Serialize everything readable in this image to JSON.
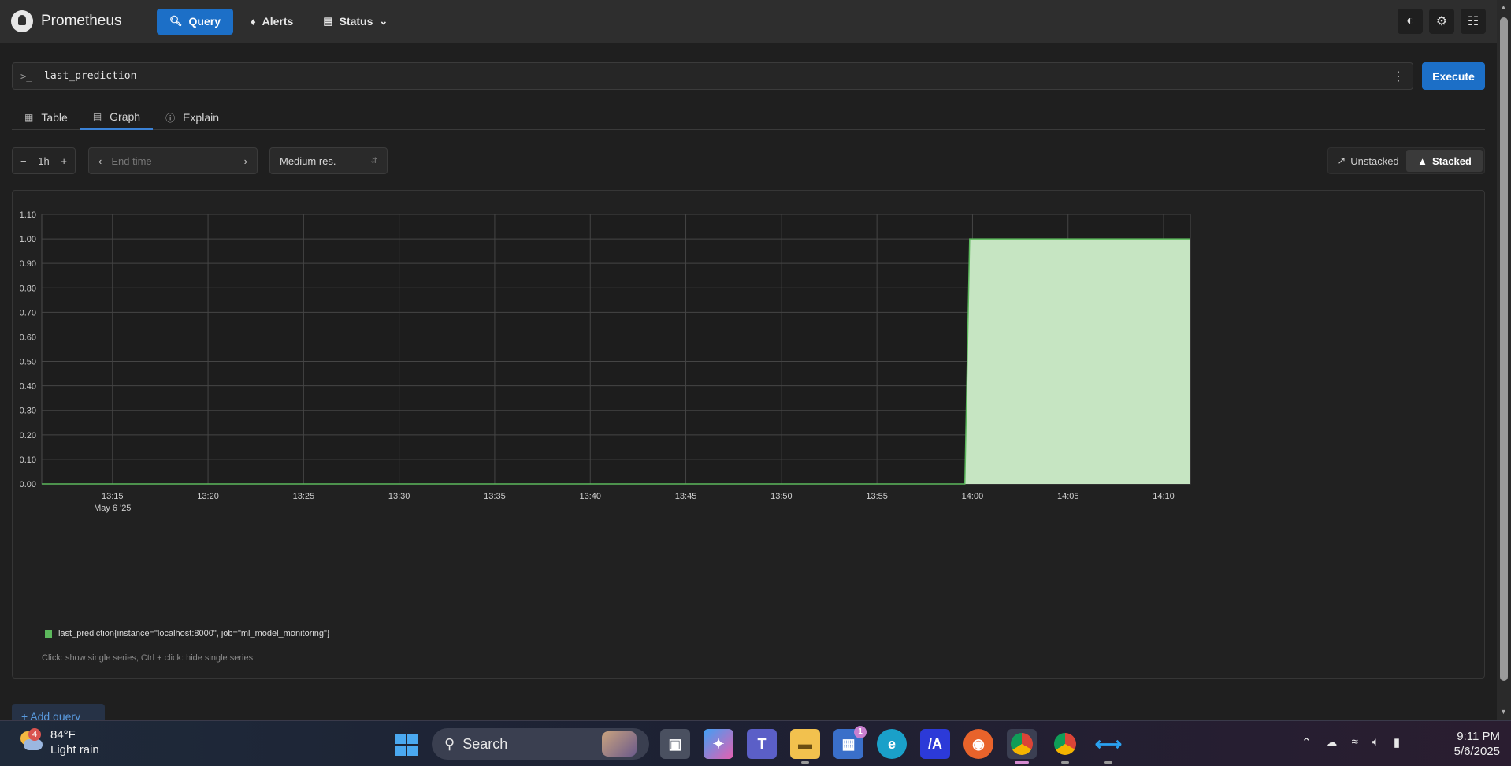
{
  "nav": {
    "brand": "Prometheus",
    "items": [
      {
        "label": "Query",
        "icon": "search-icon"
      },
      {
        "label": "Alerts",
        "icon": "bell-icon"
      },
      {
        "label": "Status",
        "icon": "server-icon"
      }
    ],
    "right_icons": [
      "contrast-icon",
      "gear-icon",
      "book-icon"
    ]
  },
  "query": {
    "prompt": ">_",
    "expression": "last_prediction",
    "execute_label": "Execute"
  },
  "tabs": [
    {
      "label": "Table",
      "icon": "table-icon"
    },
    {
      "label": "Graph",
      "icon": "graph-icon",
      "active": true
    },
    {
      "label": "Explain",
      "icon": "info-icon"
    }
  ],
  "controls": {
    "range_minus": "−",
    "range_value": "1h",
    "range_plus": "+",
    "end_time_placeholder": "End time",
    "resolution": "Medium res.",
    "unstacked_label": "Unstacked",
    "stacked_label": "Stacked",
    "mode": "stacked"
  },
  "chart_data": {
    "type": "area",
    "title": "",
    "xlabel": "",
    "ylabel": "",
    "x_ticks": [
      "13:15",
      "13:20",
      "13:25",
      "13:30",
      "13:35",
      "13:40",
      "13:45",
      "13:50",
      "13:55",
      "14:00",
      "14:05",
      "14:10"
    ],
    "x_tick_minutes": [
      15,
      20,
      25,
      30,
      35,
      40,
      45,
      50,
      55,
      60,
      65,
      70
    ],
    "x_date_label": "May 6 '25",
    "xlim_minutes": [
      11.3,
      71.4
    ],
    "y_ticks": [
      "0.00",
      "0.10",
      "0.20",
      "0.30",
      "0.40",
      "0.50",
      "0.60",
      "0.70",
      "0.80",
      "0.90",
      "1.00",
      "1.10"
    ],
    "ylim": [
      0,
      1.1
    ],
    "grid": true,
    "series": [
      {
        "name": "last_prediction{instance=\"localhost:8000\", job=\"ml_model_monitoring\"}",
        "color": "#5cb85c",
        "fill": "#c6e5c2",
        "points": [
          [
            59.6,
            0
          ],
          [
            59.85,
            1.0
          ],
          [
            71.4,
            1.0
          ]
        ]
      }
    ],
    "legend_position": "bottom-left",
    "hint": "Click: show single series, Ctrl + click: hide single series"
  },
  "add_query_label": "+ Add query",
  "taskbar": {
    "weather_temp": "84°F",
    "weather_desc": "Light rain",
    "weather_badge": "4",
    "search_label": "Search",
    "store_badge": "1",
    "time": "9:11 PM",
    "date": "5/6/2025"
  }
}
